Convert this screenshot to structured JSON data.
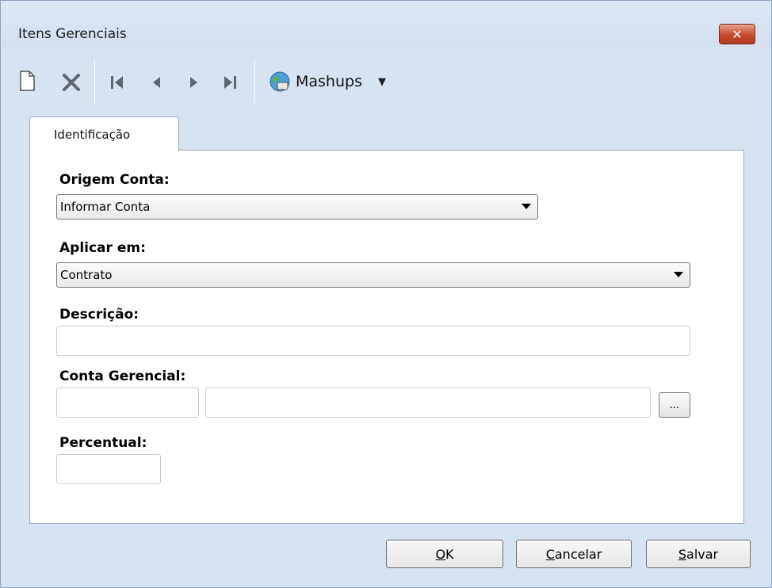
{
  "window": {
    "title": "Itens Gerenciais",
    "close_glyph": "✕"
  },
  "toolbar": {
    "icons": [
      "new-document-icon",
      "delete-icon",
      "first-record-icon",
      "previous-record-icon",
      "next-record-icon",
      "last-record-icon"
    ],
    "mashups_label": "Mashups",
    "mashups_icon": "globe-icon",
    "caret": "▼"
  },
  "tabs": [
    {
      "label": "Identificação"
    }
  ],
  "form": {
    "origem_conta": {
      "label": "Origem Conta:",
      "value": "Informar Conta"
    },
    "aplicar_em": {
      "label": "Aplicar em:",
      "value": "Contrato"
    },
    "descricao": {
      "label": "Descrição:",
      "value": ""
    },
    "conta_gerencial": {
      "label": "Conta Gerencial:",
      "code_value": "",
      "name_value": "",
      "browse_label": "..."
    },
    "percentual": {
      "label": "Percentual:",
      "value": ""
    }
  },
  "footer": {
    "ok": {
      "mnemonic": "O",
      "rest": "K"
    },
    "cancelar": {
      "mnemonic": "C",
      "rest": "ancelar"
    },
    "salvar": {
      "mnemonic": "S",
      "rest": "alvar"
    }
  },
  "colors": {
    "window_bg": "#d8e3f1",
    "close_red": "#c64a2e",
    "panel_bg": "#ffffff"
  }
}
